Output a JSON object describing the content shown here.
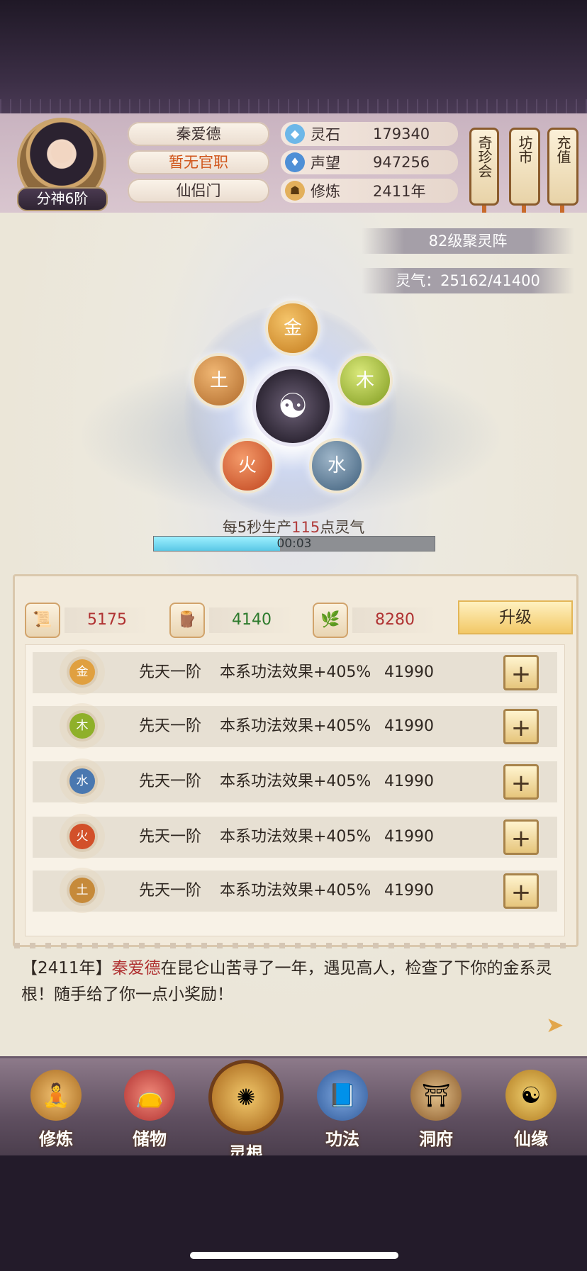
{
  "player": {
    "name": "秦爱德",
    "title": "暂无官职",
    "sect": "仙侣门",
    "rank": "分神6阶"
  },
  "resources": [
    {
      "label": "灵石",
      "value": "179340",
      "icon": "spirit-stone-icon"
    },
    {
      "label": "声望",
      "value": "947256",
      "icon": "reputation-icon"
    },
    {
      "label": "修炼",
      "value": "2411年",
      "icon": "cultivation-icon"
    }
  ],
  "side_buttons": {
    "treasure": "奇珍会",
    "market": "坊市",
    "recharge": "充值"
  },
  "array": {
    "level_label": "82级聚灵阵",
    "qi_label": "灵气：25162/41400",
    "center_icon": "taiji-icon",
    "elements": {
      "metal": "金",
      "wood": "木",
      "water": "水",
      "fire": "火",
      "earth": "土"
    },
    "production_prefix": "每5秒生产",
    "production_amount": "115",
    "production_suffix": "点灵气",
    "timer": "00:03",
    "timer_progress": 0.45
  },
  "materials": [
    {
      "icon": "book-material-icon",
      "value": "5175"
    },
    {
      "icon": "wood-material-icon",
      "value": "4140"
    },
    {
      "icon": "herb-material-icon",
      "value": "8280"
    }
  ],
  "upgrade_label": "升级",
  "roots": [
    {
      "element": "金",
      "grade": "先天一阶",
      "effect": "本系功法效果+405%",
      "cost": "41990",
      "color": "#e0a040"
    },
    {
      "element": "木",
      "grade": "先天一阶",
      "effect": "本系功法效果+405%",
      "cost": "41990",
      "color": "#8fb02a"
    },
    {
      "element": "水",
      "grade": "先天一阶",
      "effect": "本系功法效果+405%",
      "cost": "41990",
      "color": "#4a78b0"
    },
    {
      "element": "火",
      "grade": "先天一阶",
      "effect": "本系功法效果+405%",
      "cost": "41990",
      "color": "#d2502a"
    },
    {
      "element": "土",
      "grade": "先天一阶",
      "effect": "本系功法效果+405%",
      "cost": "41990",
      "color": "#c68a3a"
    }
  ],
  "plus_label": "+",
  "log": {
    "year": "【2411年】",
    "name": "秦爱德",
    "text": "在昆仑山苦寻了一年，遇见高人，检查了下你的金系灵根！随手给了你一点小奖励！"
  },
  "nav": [
    {
      "label": "修炼",
      "icon": "cultivate-icon",
      "glyph": "☯"
    },
    {
      "label": "储物",
      "icon": "storage-bag-icon",
      "glyph": "👝"
    },
    {
      "label": "灵根",
      "icon": "spirit-root-icon",
      "glyph": "✺"
    },
    {
      "label": "功法",
      "icon": "technique-book-icon",
      "glyph": "📘"
    },
    {
      "label": "洞府",
      "icon": "cave-house-icon",
      "glyph": "⛩"
    },
    {
      "label": "仙缘",
      "icon": "destiny-gourd-icon",
      "glyph": "☯"
    }
  ]
}
